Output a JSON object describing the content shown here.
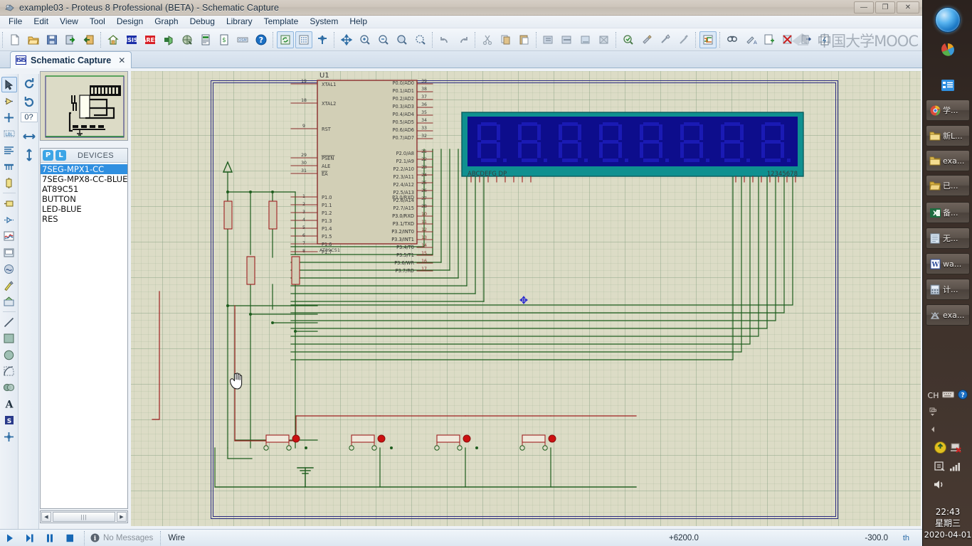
{
  "window": {
    "title": "example03 - Proteus 8 Professional (BETA) - Schematic Capture",
    "app_icon": "proteus-icon",
    "minimize_label": "—",
    "maximize_label": "❐",
    "close_label": "✕"
  },
  "menubar": {
    "items": [
      {
        "label": "File"
      },
      {
        "label": "Edit"
      },
      {
        "label": "View"
      },
      {
        "label": "Tool"
      },
      {
        "label": "Design"
      },
      {
        "label": "Graph"
      },
      {
        "label": "Debug"
      },
      {
        "label": "Library"
      },
      {
        "label": "Template"
      },
      {
        "label": "System"
      },
      {
        "label": "Help"
      }
    ]
  },
  "toolbar": {
    "groups": [
      [
        "new-document-icon",
        "open-project-icon",
        "save-project-icon",
        "import-icon",
        "export-icon"
      ],
      [
        "home-icon",
        "isis-schematic-icon",
        "ares-pcb-icon",
        "3d-viewer-icon",
        "design-explorer-icon",
        "bom-report-icon",
        "billing-icon",
        "osm-icon",
        "help-icon"
      ],
      [
        "refresh-icon",
        "toggle-grid-icon",
        "origin-icon",
        "pan-icon",
        "zoom-in-icon",
        "zoom-out-icon",
        "zoom-area-icon",
        "zoom-sheet-icon"
      ],
      [
        "undo-icon",
        "redo-icon"
      ],
      [
        "cut-icon",
        "copy-icon",
        "paste-icon",
        "block-copy-icon",
        "block-move-icon",
        "block-rotate-icon",
        "block-delete-icon"
      ],
      [
        "pick-device-icon",
        "make-device-icon",
        "packaging-tool-icon",
        "decompose-icon"
      ],
      [
        "toggle-autorouter-icon"
      ],
      [
        "search-tag-icon",
        "property-assignment-icon",
        "new-sheet-icon",
        "remove-sheet-icon",
        "exit-sheet-icon",
        "bill-of-materials-icon"
      ]
    ],
    "watermark": "中国大学MOOC"
  },
  "document_tab": {
    "icon": "isis-icon",
    "badge": "ISIS",
    "label": "Schematic Capture",
    "close": "✕"
  },
  "mode_toolbar": {
    "items": [
      {
        "name": "selection-mode-icon",
        "selected": true
      },
      {
        "name": "component-mode-icon",
        "selected": false
      },
      {
        "name": "junction-dot-mode-icon",
        "selected": false
      },
      {
        "name": "wire-label-mode-icon",
        "selected": false
      },
      {
        "name": "text-script-mode-icon",
        "selected": false
      },
      {
        "name": "bus-mode-icon",
        "selected": false
      },
      {
        "name": "subcircuit-mode-icon",
        "selected": false
      },
      {
        "name": "terminals-mode-icon",
        "selected": false
      },
      {
        "name": "device-pins-mode-icon",
        "selected": false
      },
      {
        "name": "graph-mode-icon",
        "selected": false
      },
      {
        "name": "tape-recorder-mode-icon",
        "selected": false
      },
      {
        "name": "generator-mode-icon",
        "selected": false
      },
      {
        "name": "voltage-probe-mode-icon",
        "selected": false
      },
      {
        "name": "virtual-instrument-mode-icon",
        "selected": false
      },
      {
        "name": "line-tool-icon",
        "selected": false
      },
      {
        "name": "box-tool-icon",
        "selected": false
      },
      {
        "name": "circle-tool-icon",
        "selected": false
      },
      {
        "name": "arc-tool-icon",
        "selected": false
      },
      {
        "name": "path-tool-icon",
        "selected": false
      },
      {
        "name": "text-tool-icon",
        "selected": false
      },
      {
        "name": "symbol-tool-icon",
        "selected": false
      },
      {
        "name": "marker-tool-icon",
        "selected": false
      }
    ]
  },
  "orientation": {
    "rotate_cw_icon": "rotate-clockwise-icon",
    "rotate_ccw_icon": "rotate-counterclockwise-icon",
    "rotation_value": "0?",
    "mirror_x_icon": "mirror-horizontal-icon",
    "mirror_y_icon": "mirror-vertical-icon"
  },
  "devices_panel": {
    "pick_button": "P",
    "library_button": "L",
    "title": "DEVICES",
    "items": [
      {
        "label": "7SEG-MPX1-CC",
        "selected": true
      },
      {
        "label": "7SEG-MPX8-CC-BLUE",
        "selected": false
      },
      {
        "label": "AT89C51",
        "selected": false
      },
      {
        "label": "BUTTON",
        "selected": false
      },
      {
        "label": "LED-BLUE",
        "selected": false
      },
      {
        "label": "RES",
        "selected": false
      }
    ],
    "scroll_thumb": "|||"
  },
  "schematic": {
    "mcu": {
      "reference": "U1",
      "part_number": "AT89C51",
      "left_pins": [
        {
          "pin": "19",
          "label": "XTAL1"
        },
        {
          "pin": "18",
          "label": "XTAL2"
        },
        {
          "pin": "9",
          "label": "RST"
        },
        {
          "pin": "29",
          "label": "PSEN"
        },
        {
          "pin": "30",
          "label": "ALE"
        },
        {
          "pin": "31",
          "label": "EA"
        },
        {
          "pin": "1",
          "label": "P1.0"
        },
        {
          "pin": "2",
          "label": "P1.1"
        },
        {
          "pin": "3",
          "label": "P1.2"
        },
        {
          "pin": "4",
          "label": "P1.3"
        },
        {
          "pin": "5",
          "label": "P1.4"
        },
        {
          "pin": "6",
          "label": "P1.5"
        },
        {
          "pin": "7",
          "label": "P1.6"
        },
        {
          "pin": "8",
          "label": "P1.7"
        }
      ],
      "right_pins": [
        {
          "pin": "39",
          "label": "P0.0/AD0"
        },
        {
          "pin": "38",
          "label": "P0.1/AD1"
        },
        {
          "pin": "37",
          "label": "P0.2/AD2"
        },
        {
          "pin": "36",
          "label": "P0.3/AD3"
        },
        {
          "pin": "35",
          "label": "P0.4/AD4"
        },
        {
          "pin": "34",
          "label": "P0.5/AD5"
        },
        {
          "pin": "33",
          "label": "P0.6/AD6"
        },
        {
          "pin": "32",
          "label": "P0.7/AD7"
        },
        {
          "pin": "21",
          "label": "P2.0/A8"
        },
        {
          "pin": "22",
          "label": "P2.1/A9"
        },
        {
          "pin": "23",
          "label": "P2.2/A10"
        },
        {
          "pin": "24",
          "label": "P2.3/A11"
        },
        {
          "pin": "25",
          "label": "P2.4/A12"
        },
        {
          "pin": "26",
          "label": "P2.5/A13"
        },
        {
          "pin": "27",
          "label": "P2.6/A14"
        },
        {
          "pin": "28",
          "label": "P2.7/A15"
        },
        {
          "pin": "10",
          "label": "P3.0/RXD"
        },
        {
          "pin": "11",
          "label": "P3.1/TXD"
        },
        {
          "pin": "12",
          "label": "P3.2/INT0"
        },
        {
          "pin": "13",
          "label": "P3.3/INT1"
        },
        {
          "pin": "14",
          "label": "P3.4/T0"
        },
        {
          "pin": "15",
          "label": "P3.5/T1"
        },
        {
          "pin": "16",
          "label": "P3.6/WR"
        },
        {
          "pin": "17",
          "label": "P3.7/RD"
        }
      ]
    },
    "display": {
      "component": "7SEG-MPX8-CC-BLUE",
      "segment_labels": "ABCDEFG DP",
      "digit_labels": "12345678",
      "digit_count": 8,
      "body_color": "#0f9090",
      "screen_color": "#0d0d8c",
      "segment_off_color": "#1a1ab4"
    },
    "buttons": {
      "count": 4,
      "label": "BUTTON"
    },
    "resistors": {
      "count": 4,
      "label": "RES"
    },
    "power_symbol": "vcc-power-icon",
    "ground_symbol": "ground-icon",
    "cursor": "hand-cursor",
    "marker": "move-marker-icon"
  },
  "statusbar": {
    "play_icon": "run-simulation-icon",
    "step_icon": "step-simulation-icon",
    "pause_icon": "pause-simulation-icon",
    "stop_icon": "stop-simulation-icon",
    "message_icon": "info-icon",
    "message": "No Messages",
    "mode": "Wire",
    "coord_x": "+6200.0",
    "coord_y": "-300.0",
    "extra": "th"
  },
  "sidebar": {
    "start_button": "windows-start-orb",
    "quick_launch": [
      {
        "name": "media-player-icon"
      },
      {
        "name": "show-desktop-icon"
      }
    ],
    "tasks": [
      {
        "icon": "chrome-icon",
        "label": "学..."
      },
      {
        "icon": "folder-icon",
        "label": "新L..."
      },
      {
        "icon": "folder-icon",
        "label": "exa..."
      },
      {
        "icon": "folder-open-icon",
        "label": "已..."
      },
      {
        "icon": "excel-icon",
        "label": "备..."
      },
      {
        "icon": "notepad-icon",
        "label": "无..."
      },
      {
        "icon": "winrar-icon",
        "label": "wa..."
      },
      {
        "icon": "calculator-icon",
        "label": "计..."
      },
      {
        "icon": "proteus-icon",
        "label": "exa..."
      }
    ],
    "tray": {
      "ime": "CH",
      "keyboard_icon": "keyboard-icon",
      "help_icon": "help-circle-icon",
      "network_expand_icon": "expand-tray-icon",
      "show_hidden_icon": "show-hidden-icons-arrow",
      "update_icon": "update-shield-icon",
      "network_icon": "network-disconnected-icon",
      "security_icon": "security-icon",
      "signal_icon": "signal-bars-icon",
      "volume_icon": "volume-icon"
    },
    "clock": {
      "time": "22:43",
      "weekday": "星期三",
      "date": "2020-04-01"
    }
  },
  "colors": {
    "canvas_bg": "#dcdcc6",
    "wire_green": "#1d5c1d",
    "wire_red": "#9e2020",
    "component_outline": "#8b2b2b",
    "component_fill": "#cfccb3",
    "selection_blue": "#2f8fe0",
    "display_teal": "#0f9090"
  }
}
